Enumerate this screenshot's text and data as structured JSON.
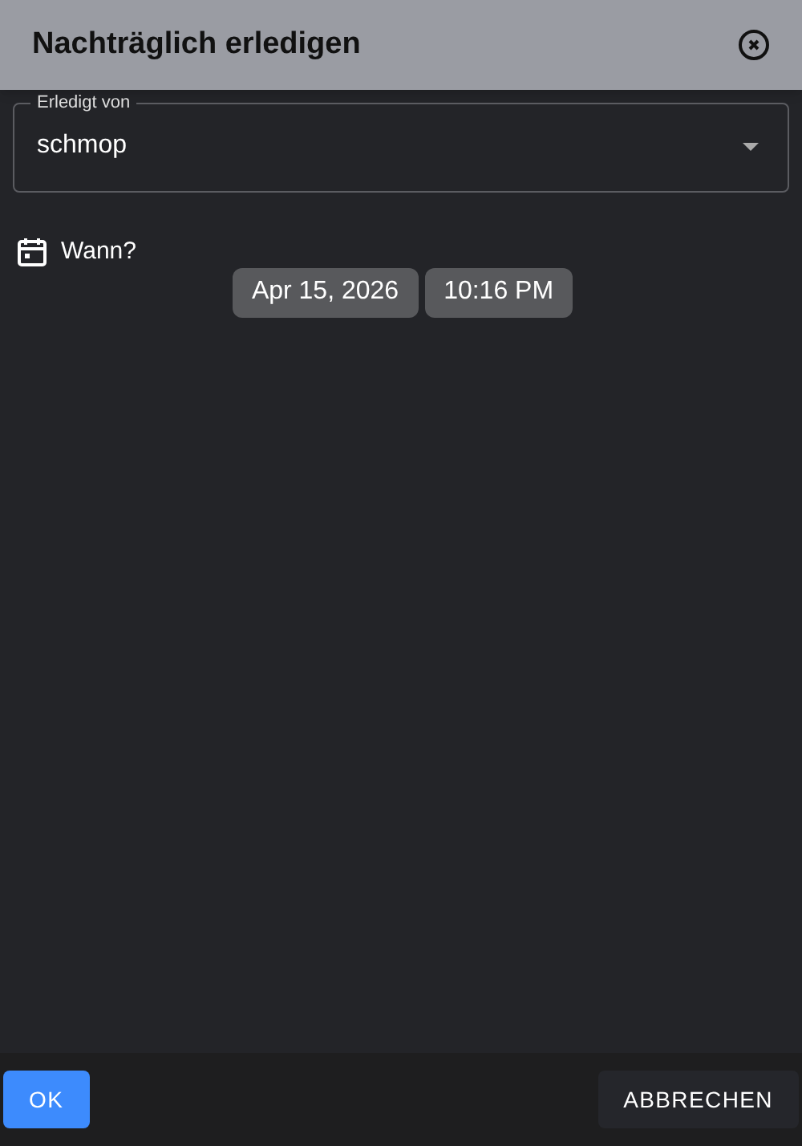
{
  "dialog": {
    "title": "Nachträglich erledigen"
  },
  "done_by": {
    "label": "Erledigt von",
    "value": "schmop"
  },
  "when": {
    "label": "Wann?",
    "date": "Apr 15, 2026",
    "time": "10:16 PM"
  },
  "buttons": [
    {
      "kind": "primary",
      "label": "OK"
    },
    {
      "kind": "secondary",
      "label": "ABBRECHEN"
    }
  ]
}
